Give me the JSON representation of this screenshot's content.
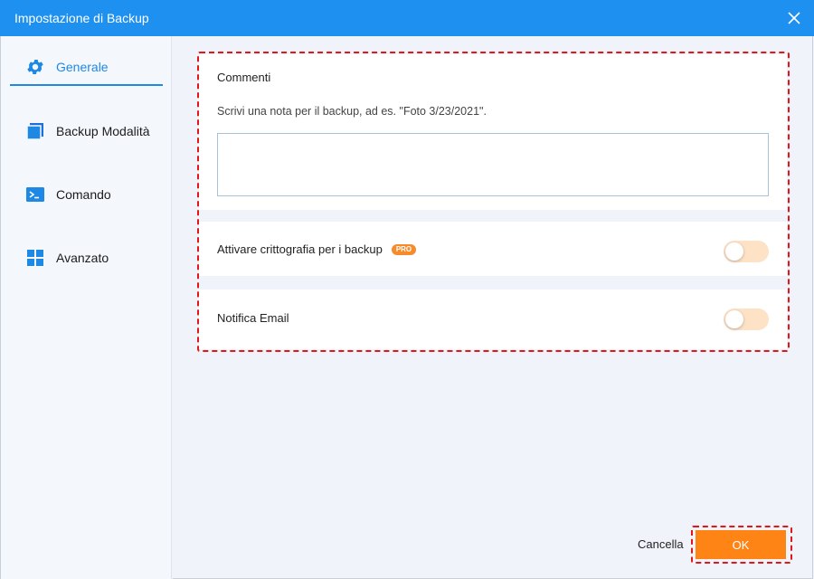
{
  "window": {
    "title": "Impostazione di Backup",
    "close_icon": "close-icon"
  },
  "sidebar": {
    "items": [
      {
        "label": "Generale",
        "icon": "gear-icon",
        "active": true
      },
      {
        "label": "Backup Modalità",
        "icon": "stack-icon",
        "active": false
      },
      {
        "label": "Comando",
        "icon": "terminal-icon",
        "active": false
      },
      {
        "label": "Avanzato",
        "icon": "grid-icon",
        "active": false
      }
    ]
  },
  "general": {
    "comments_title": "Commenti",
    "comments_hint": "Scrivi una nota per il backup, ad es. \"Foto 3/23/2021\".",
    "comments_value": "",
    "encryption_label": "Attivare crittografia per i backup",
    "encryption_badge": "PRO",
    "encryption_enabled": false,
    "email_label": "Notifica Email",
    "email_enabled": false
  },
  "footer": {
    "cancel_label": "Cancella",
    "ok_label": "OK"
  },
  "colors": {
    "titlebar": "#1e90f0",
    "accent": "#1e88e5",
    "ok_button": "#ff8416",
    "toggle_off": "#fde2c6",
    "highlight_border": "#e01818"
  }
}
